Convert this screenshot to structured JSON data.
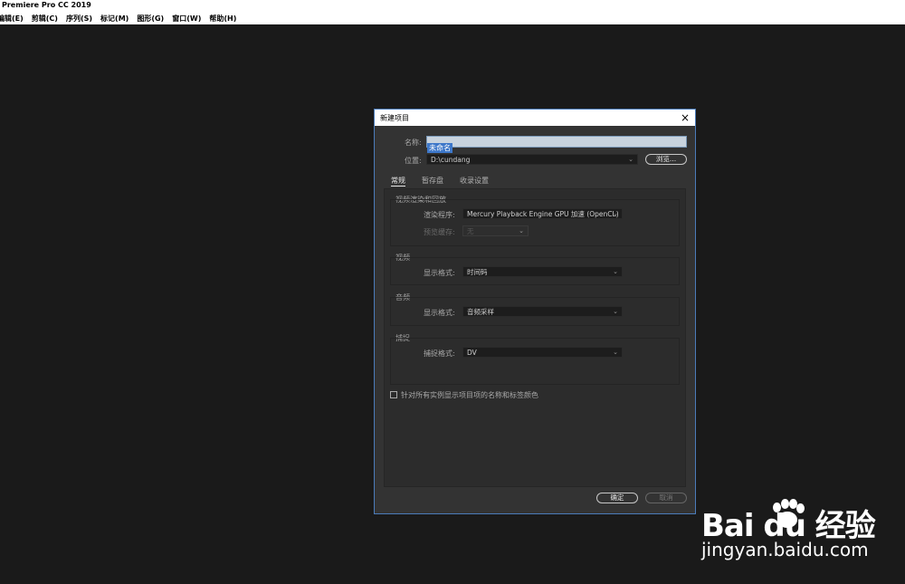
{
  "app": {
    "title": "Premiere Pro CC 2019"
  },
  "menu": [
    "编辑(E)",
    "剪辑(C)",
    "序列(S)",
    "标记(M)",
    "图形(G)",
    "窗口(W)",
    "帮助(H)"
  ],
  "dialog": {
    "title": "新建项目",
    "close_icon": "×",
    "name_label": "名称:",
    "name_value": "未命名",
    "location_label": "位置:",
    "location_value": "D:\\cundang",
    "browse_label": "浏览...",
    "tabs": [
      "常规",
      "暂存盘",
      "收录设置"
    ],
    "active_tab": "常规",
    "groups": {
      "render": {
        "title": "视频渲染和回放",
        "renderer_label": "渲染程序:",
        "renderer_value": "Mercury Playback Engine GPU 加速 (OpenCL)",
        "preview_cache_label": "预览缓存:",
        "preview_cache_value": "无"
      },
      "video": {
        "title": "视频",
        "display_format_label": "显示格式:",
        "display_format_value": "时间码"
      },
      "audio": {
        "title": "音频",
        "display_format_label": "显示格式:",
        "display_format_value": "音频采样"
      },
      "capture": {
        "title": "捕捉",
        "capture_format_label": "捕捉格式:",
        "capture_format_value": "DV"
      }
    },
    "checkbox_label": "针对所有实例显示项目项的名称和标签颜色",
    "checkbox_checked": false,
    "ok_label": "确定",
    "cancel_label": "取消"
  },
  "watermark": {
    "brand": "Bai du 经验",
    "url": "jingyan.baidu.com"
  },
  "colors": {
    "background": "#1a1a1a",
    "dialog": "#333333",
    "selection": "#3d77c9",
    "dialog_border": "#4b7cba"
  }
}
